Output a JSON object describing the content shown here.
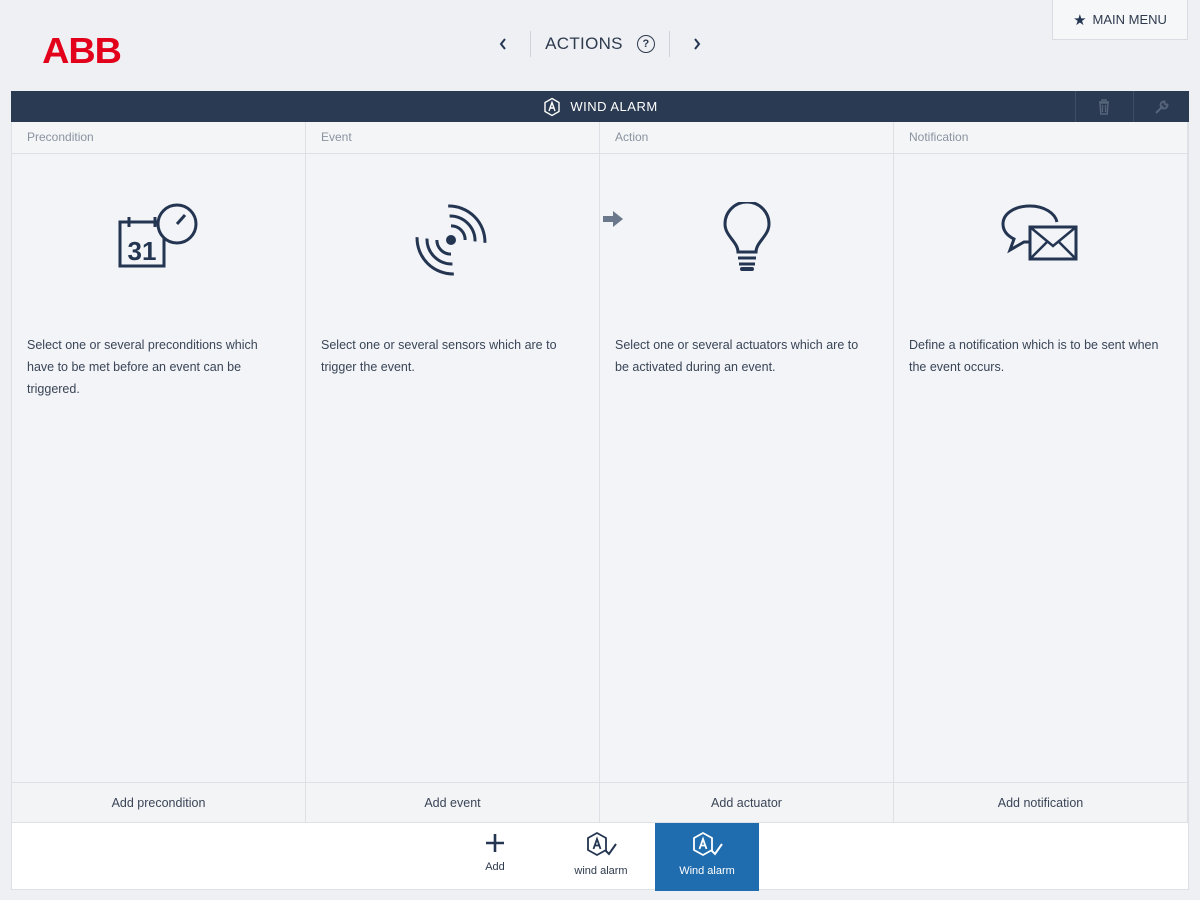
{
  "brand": {
    "logo_text": "ABB"
  },
  "top_nav": {
    "title": "ACTIONS",
    "help_symbol": "?",
    "prev_symbol": "‹",
    "next_symbol": "›"
  },
  "main_menu": {
    "label": "MAIN MENU",
    "icon": "star-icon"
  },
  "title_bar": {
    "title": "WIND ALARM",
    "icons": [
      "automation-icon",
      "trash-icon",
      "wrench-icon"
    ]
  },
  "columns": [
    {
      "header": "Precondition",
      "icon": "calendar-clock-icon",
      "calendar_day": "31",
      "description": "Select one or several preconditions which have to be met before an event can be triggered.",
      "footer": "Add precondition"
    },
    {
      "header": "Event",
      "icon": "sensor-signal-icon",
      "description": "Select one or several sensors which are to trigger the event.",
      "footer": "Add event"
    },
    {
      "header": "Action",
      "icon": "light-bulb-icon",
      "description": "Select one or several actuators which are to be activated during an event.",
      "footer": "Add actuator"
    },
    {
      "header": "Notification",
      "icon": "message-mail-icon",
      "description": "Define a notification which is to be sent when the event occurs.",
      "footer": "Add notification"
    }
  ],
  "bottom_bar": {
    "items": [
      {
        "label": "Add",
        "icon": "plus-icon",
        "active": false
      },
      {
        "label": "wind alarm",
        "icon": "automation-check-icon",
        "active": false
      },
      {
        "label": "Wind alarm",
        "icon": "automation-check-icon",
        "active": true
      }
    ]
  },
  "colors": {
    "brand_red": "#e2001a",
    "header_dark": "#2a3a52",
    "active_blue": "#1f6cae",
    "icon_navy": "#243552"
  }
}
